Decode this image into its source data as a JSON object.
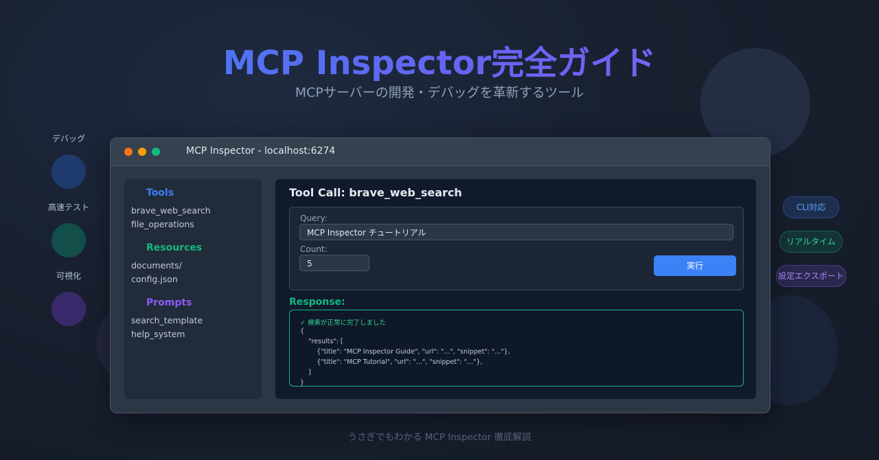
{
  "hero": {
    "title": "MCP Inspector完全ガイド",
    "subtitle": "MCPサーバーの開発・デバッグを革新するツール"
  },
  "features_left": [
    {
      "label": "デバッグ",
      "color": "#1e3a6e"
    },
    {
      "label": "高速テスト",
      "color": "#134e4a"
    },
    {
      "label": "可視化",
      "color": "#3b2a6b"
    }
  ],
  "features_right": [
    {
      "label": "CLI対応",
      "color": "#60a5fa"
    },
    {
      "label": "リアルタイム",
      "color": "#34d399"
    },
    {
      "label": "設定エクスポート",
      "color": "#a78bfa"
    }
  ],
  "window": {
    "title": "MCP Inspector - localhost:6274",
    "traffic_lights": [
      "#f97316",
      "#f59e0b",
      "#10b981"
    ]
  },
  "sidebar": {
    "tools": {
      "heading": "Tools",
      "color": "#3b82f6",
      "items": [
        "brave_web_search",
        "file_operations"
      ]
    },
    "resources": {
      "heading": "Resources",
      "color": "#10b981",
      "items": [
        "documents/",
        "config.json"
      ]
    },
    "prompts": {
      "heading": "Prompts",
      "color": "#8b5cf6",
      "items": [
        "search_template",
        "help_system"
      ]
    }
  },
  "main": {
    "title": "Tool Call: brave_web_search",
    "query_label": "Query:",
    "query_value": "MCP Inspector チュートリアル",
    "count_label": "Count:",
    "count_value": "5",
    "run_label": "実行",
    "response_label": "Response:",
    "response_status": "✓ 検索が正常に完了しました",
    "response_lines": [
      "{",
      "    \"results\": [",
      "        {\"title\": \"MCP Inspector Guide\", \"url\": \"...\", \"snippet\": \"...\"},",
      "        {\"title\": \"MCP Tutorial\", \"url\": \"...\", \"snippet\": \"...\"},",
      "    ]",
      "}"
    ]
  },
  "footer": "うさぎでもわかる MCP Inspector 徹底解説",
  "colors": {
    "accent_blue": "#3b82f6",
    "accent_green": "#10b981",
    "accent_purple": "#8b5cf6"
  }
}
